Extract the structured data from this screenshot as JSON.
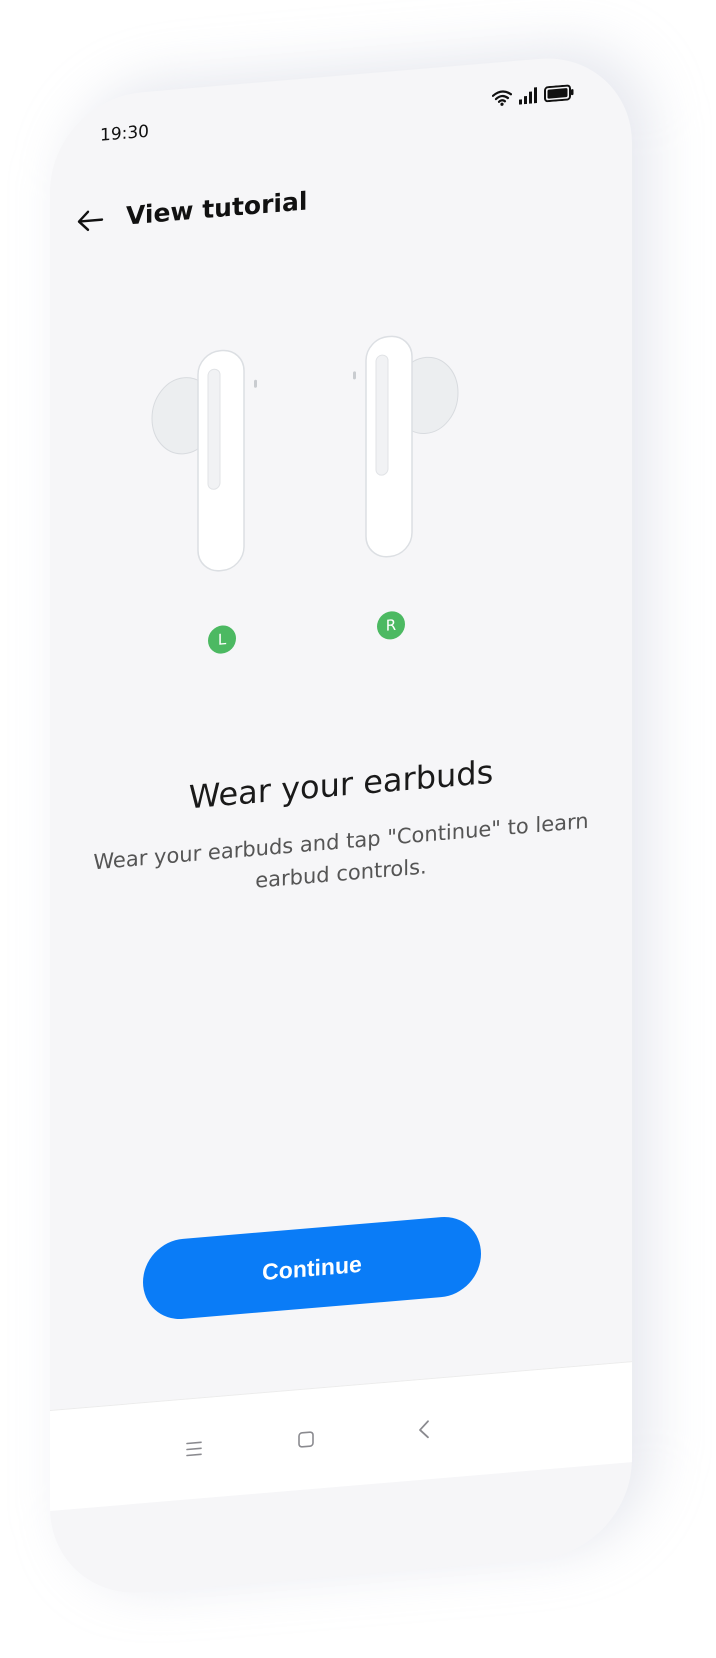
{
  "status_bar": {
    "time": "19:30",
    "icons": [
      "wifi-icon",
      "signal-icon",
      "battery-icon"
    ]
  },
  "header": {
    "back_icon": "back-arrow-icon",
    "title": "View tutorial"
  },
  "earbuds": {
    "left_label": "L",
    "right_label": "R"
  },
  "content": {
    "title": "Wear your earbuds",
    "description": "Wear your earbuds and tap \"Continue\" to learn earbud controls."
  },
  "actions": {
    "continue_label": "Continue"
  },
  "nav_bar": {
    "icons": [
      "menu-icon",
      "home-icon",
      "back-icon"
    ]
  },
  "colors": {
    "accent": "#0a7cf7",
    "badge": "#4cb962",
    "background": "#f6f6f8"
  }
}
